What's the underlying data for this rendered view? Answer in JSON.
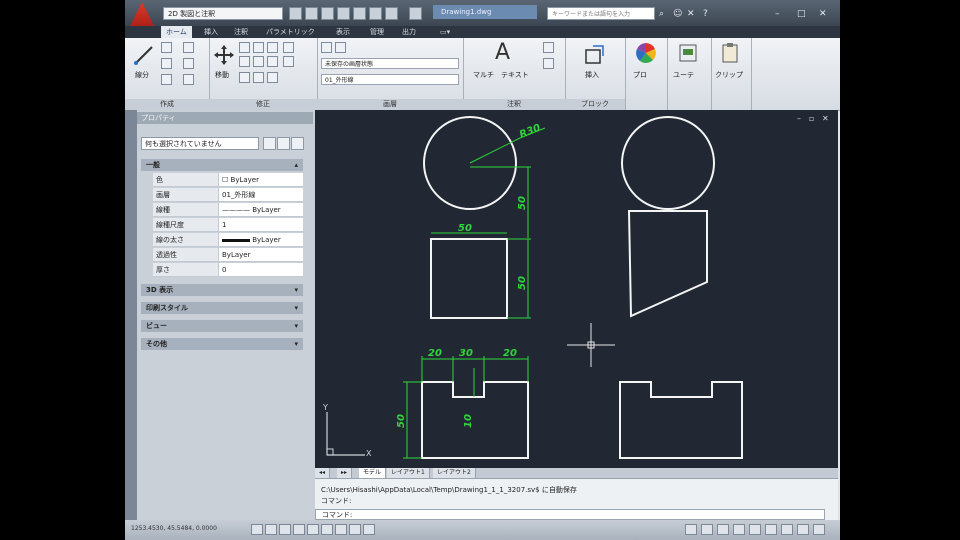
{
  "titlebar": {
    "workspace": "2D 製図と注釈",
    "document_title": "Drawing1.dwg",
    "search_placeholder": "キーワードまたは語句を入力",
    "help": "?"
  },
  "ribbon_tabs": [
    "ホーム",
    "挿入",
    "注釈",
    "パラメトリック",
    "表示",
    "管理",
    "出力"
  ],
  "ribbon": {
    "panels": [
      "作成",
      "修正",
      "画層",
      "注釈",
      "ブロック"
    ],
    "line_label": "線分",
    "move_label": "移動",
    "layer_state": "未保存の画層状態",
    "layer_current": "01_外形線",
    "text_label": "テキスト",
    "mtext_label": "マルチ",
    "insert_label": "挿入",
    "properties_label": "プロ",
    "utilities_label": "ユーテ",
    "clipboard_label": "クリップ"
  },
  "properties": {
    "title": "プロパティ",
    "selection": "何も選択されていません",
    "sections": {
      "general": "一般",
      "view3d": "3D 表示",
      "plot_style": "印刷スタイル",
      "view": "ビュー",
      "misc": "その他"
    },
    "rows": [
      {
        "key": "色",
        "value": "ByLayer"
      },
      {
        "key": "画層",
        "value": "01_外形線"
      },
      {
        "key": "線種",
        "value": "———— ByLayer"
      },
      {
        "key": "線種尺度",
        "value": "1"
      },
      {
        "key": "線の太さ",
        "value": "ByLayer"
      },
      {
        "key": "透過性",
        "value": "ByLayer"
      },
      {
        "key": "厚さ",
        "value": "0"
      }
    ]
  },
  "drawing": {
    "dim_radius": "R30",
    "dim_50_top": "50",
    "dim_50_right_upper": "50",
    "dim_50_right_lower": "50",
    "dim_20_left": "20",
    "dim_30_mid": "30",
    "dim_20_right": "20",
    "dim_50_left": "50",
    "dim_10": "10",
    "ucs_x": "X",
    "ucs_y": "Y"
  },
  "layout_tabs": [
    "モデル",
    "レイアウト1",
    "レイアウト2"
  ],
  "command": {
    "history": "C:\\Users\\Hisashi\\AppData\\Local\\Temp\\Drawing1_1_1_3207.sv$ に自動保存",
    "line1": "コマンド:",
    "line2": "コマンド:",
    "prompt": ""
  },
  "status": {
    "coords": "1253.4530, 45.5484, 0.0000"
  },
  "colors": {
    "viewport_bg": "#212833",
    "geometry": "#f4f4f4",
    "dimension": "#2fd63a"
  }
}
